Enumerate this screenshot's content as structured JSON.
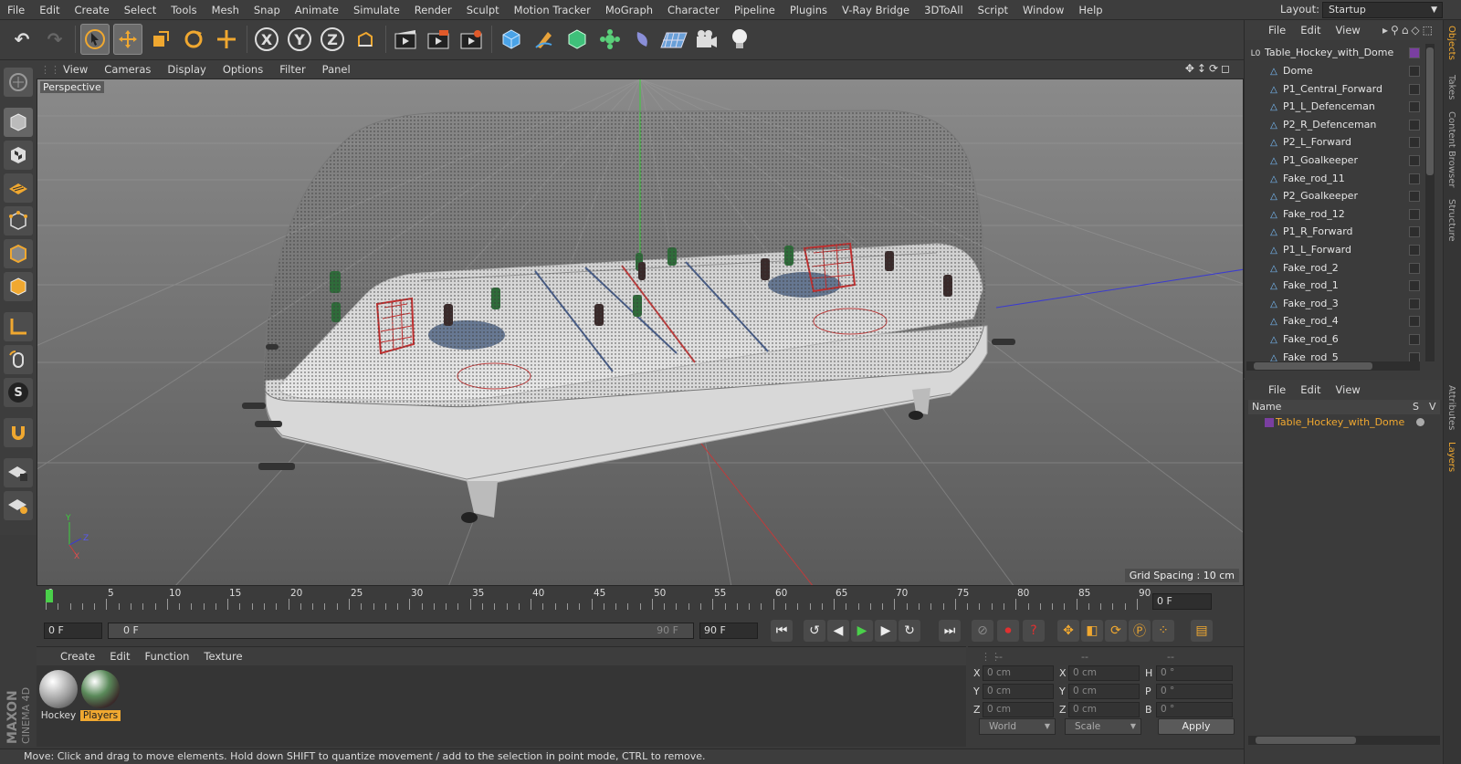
{
  "menubar": {
    "items": [
      "File",
      "Edit",
      "Create",
      "Select",
      "Tools",
      "Mesh",
      "Snap",
      "Animate",
      "Simulate",
      "Render",
      "Sculpt",
      "Motion Tracker",
      "MoGraph",
      "Character",
      "Pipeline",
      "Plugins",
      "V-Ray Bridge",
      "3DToAll",
      "Script",
      "Window",
      "Help"
    ],
    "layout_label": "Layout:",
    "layout_value": "Startup"
  },
  "toolbar": {
    "x_label": "X",
    "y_label": "Y",
    "z_label": "Z",
    "icons": [
      "undo-icon",
      "redo-icon",
      "select-arrow-icon",
      "move-icon",
      "scale-icon",
      "rotate-icon",
      "transform-icon",
      "axis-x-icon",
      "axis-y-icon",
      "axis-z-icon",
      "world-coords-icon",
      "render-view-icon",
      "render-picture-icon",
      "render-settings-icon",
      "cube-icon",
      "pen-icon",
      "subdivision-icon",
      "cloner-icon",
      "deformer-icon",
      "floor-icon",
      "camera-icon",
      "light-icon"
    ]
  },
  "viewport": {
    "menu": [
      "View",
      "Cameras",
      "Display",
      "Options",
      "Filter",
      "Panel"
    ],
    "label": "Perspective",
    "grid_spacing": "Grid Spacing : 10 cm",
    "nav_icons": [
      "move-view-icon",
      "zoom-view-icon",
      "rotate-view-icon",
      "maximize-view-icon"
    ]
  },
  "timeline": {
    "ticks": [
      "0",
      "5",
      "10",
      "15",
      "20",
      "25",
      "30",
      "35",
      "40",
      "45",
      "50",
      "55",
      "60",
      "65",
      "70",
      "75",
      "80",
      "85",
      "90"
    ],
    "current_frame": "0 F"
  },
  "playbar": {
    "start_field": "0 F",
    "range_start": "0 F",
    "range_end": "90 F",
    "end_field": "90 F"
  },
  "material_manager": {
    "menu": [
      "Create",
      "Edit",
      "Function",
      "Texture"
    ],
    "materials": [
      {
        "name": "Hockey",
        "selected": false
      },
      {
        "name": "Players",
        "selected": true
      }
    ]
  },
  "coordinates": {
    "header_left": "--",
    "header_mid": "--",
    "header_right": "--",
    "rows": [
      {
        "l1": "X",
        "v1": "0 cm",
        "l2": "X",
        "v2": "0 cm",
        "l3": "H",
        "v3": "0 °"
      },
      {
        "l1": "Y",
        "v1": "0 cm",
        "l2": "Y",
        "v2": "0 cm",
        "l3": "P",
        "v3": "0 °"
      },
      {
        "l1": "Z",
        "v1": "0 cm",
        "l2": "Z",
        "v2": "0 cm",
        "l3": "B",
        "v3": "0 °"
      }
    ],
    "mode_select": "World",
    "scale_select": "Scale",
    "apply_label": "Apply"
  },
  "status": {
    "text": "Move: Click and drag to move elements. Hold down SHIFT to quantize movement / add to the selection in point mode, CTRL to remove."
  },
  "brand": {
    "line1": "MAXON",
    "line2": "CINEMA 4D"
  },
  "object_manager": {
    "menu": [
      "File",
      "Edit",
      "View"
    ],
    "root": "Table_Hockey_with_Dome",
    "children": [
      "Dome",
      "P1_Central_Forward",
      "P1_L_Defenceman",
      "P2_R_Defenceman",
      "P2_L_Forward",
      "P1_Goalkeeper",
      "Fake_rod_11",
      "P2_Goalkeeper",
      "Fake_rod_12",
      "P1_R_Forward",
      "P1_L_Forward",
      "Fake_rod_2",
      "Fake_rod_1",
      "Fake_rod_3",
      "Fake_rod_4",
      "Fake_rod_6",
      "Fake_rod_5"
    ]
  },
  "layer_manager": {
    "menu": [
      "File",
      "Edit",
      "View"
    ],
    "col_name": "Name",
    "col_s": "S",
    "col_v": "V",
    "layer": "Table_Hockey_with_Dome"
  },
  "side_tabs": [
    "Objects",
    "Takes",
    "Content Browser",
    "Structure",
    "Attributes",
    "Layers"
  ],
  "colors": {
    "accent_orange": "#f0a830",
    "layer_color": "#7a3fa0",
    "selection_blue": "#2f6fb0"
  }
}
